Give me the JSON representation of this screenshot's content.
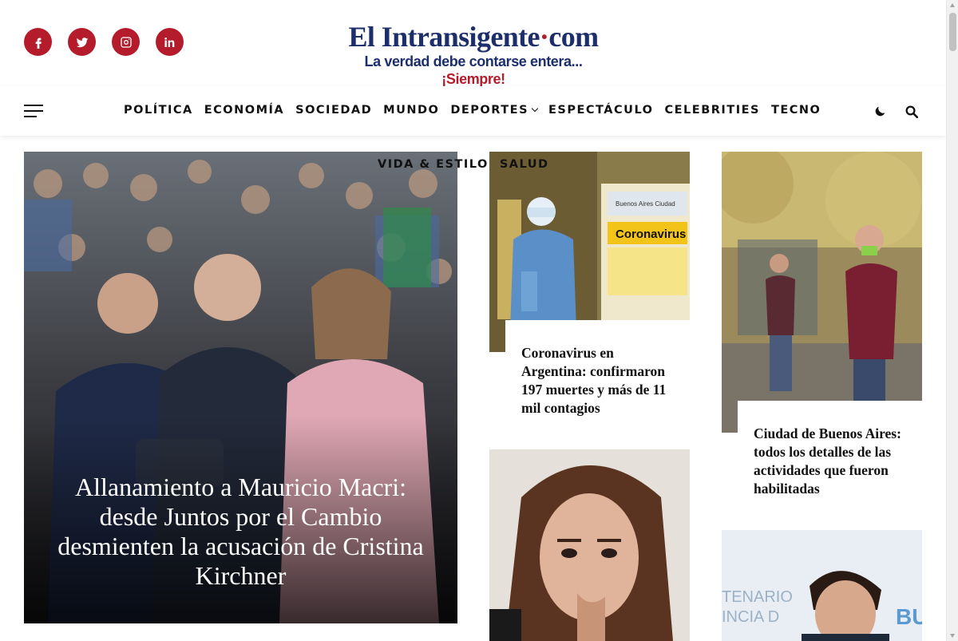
{
  "site": {
    "name_main": "El Intransigente",
    "name_dot": "·",
    "name_tld": "com",
    "tagline_main": "La verdad debe contarse entera...",
    "tagline_accent": "¡Siempre!"
  },
  "social": [
    {
      "label": "f",
      "icon": "facebook-icon"
    },
    {
      "label": "t",
      "icon": "twitter-icon"
    },
    {
      "label": "ig",
      "icon": "instagram-icon"
    },
    {
      "label": "in",
      "icon": "linkedin-icon"
    }
  ],
  "nav": {
    "items": [
      "POLÍTICA",
      "ECONOMÍA",
      "SOCIEDAD",
      "MUNDO",
      "DEPORTES",
      "ESPECTÁCULO",
      "CELEBRITIES",
      "TECNO"
    ],
    "items_row2": [
      "VIDA & ESTILO",
      "SALUD"
    ]
  },
  "articles": {
    "feature": {
      "title": "Allanamiento a Mauricio Macri: desde Juntos por el Cambio desmienten la acusación de Cristina Kirchner"
    },
    "card1": {
      "title": "Coronavirus en Argentina: confirmaron 197 muertes y más de 11 mil contagios",
      "sign_text": "Coronavirus",
      "sign_city": "Buenos Aires Ciudad"
    },
    "card2": {
      "title": "Ciudad de Buenos Aires: todos los detalles de las actividades que fueron habilitadas"
    },
    "card4": {
      "backdrop_text": "BU"
    }
  },
  "colors": {
    "brand_red": "#b51c2b",
    "brand_blue": "#1c2f6b"
  }
}
